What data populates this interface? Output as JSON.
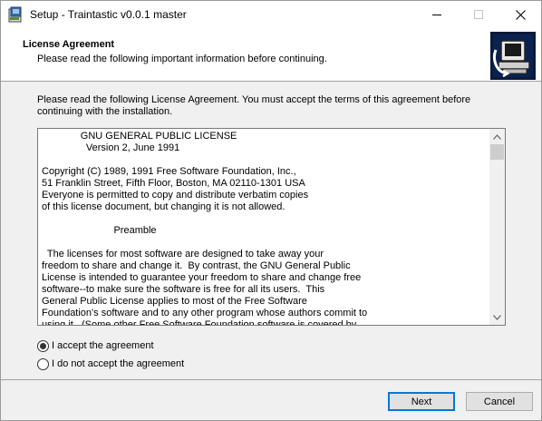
{
  "window": {
    "title": "Setup - Traintastic v0.0.1 master"
  },
  "header": {
    "title": "License Agreement",
    "subtitle": "Please read the following important information before continuing."
  },
  "body": {
    "intro": "Please read the following License Agreement. You must accept the terms of this agreement before continuing with the installation.",
    "license_lines": [
      "              GNU GENERAL PUBLIC LICENSE",
      "                Version 2, June 1991",
      "",
      "Copyright (C) 1989, 1991 Free Software Foundation, Inc.,",
      "51 Franklin Street, Fifth Floor, Boston, MA 02110-1301 USA",
      "Everyone is permitted to copy and distribute verbatim copies",
      "of this license document, but changing it is not allowed.",
      "",
      "                          Preamble",
      "",
      "  The licenses for most software are designed to take away your",
      "freedom to share and change it.  By contrast, the GNU General Public",
      "License is intended to guarantee your freedom to share and change free",
      "software--to make sure the software is free for all its users.  This",
      "General Public License applies to most of the Free Software",
      "Foundation's software and to any other program whose authors commit to",
      "using it.  (Some other Free Software Foundation software is covered by"
    ],
    "options": [
      {
        "label": "I accept the agreement",
        "selected": true
      },
      {
        "label": "I do not accept the agreement",
        "selected": false
      }
    ]
  },
  "buttons": {
    "next": "Next",
    "cancel": "Cancel"
  },
  "icons": {
    "app": "setup-app-icon",
    "header": "computer-install-icon",
    "minimize": "minimize-icon",
    "maximize": "maximize-icon",
    "close": "close-icon",
    "scroll_up": "scroll-up-arrow-icon",
    "scroll_down": "scroll-down-arrow-icon"
  },
  "colors": {
    "accent": "#0078d7",
    "dialog_bg": "#f0f0f0"
  }
}
